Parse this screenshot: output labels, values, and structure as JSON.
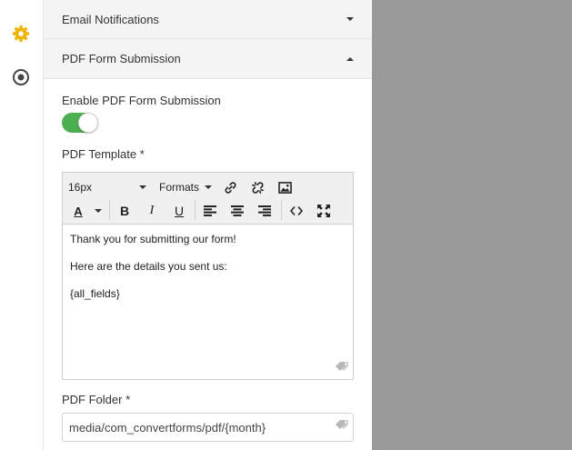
{
  "rail": {
    "icons": [
      "gear-icon",
      "target-icon"
    ],
    "gear_color": "#f0b400"
  },
  "accordion": {
    "email_notifications": {
      "label": "Email Notifications"
    },
    "pdf_form_submission": {
      "label": "PDF Form Submission"
    }
  },
  "pdf": {
    "enable_label": "Enable PDF Form Submission",
    "enabled": true,
    "toggle_color": "#4caf50",
    "template_label": "PDF Template *",
    "editor": {
      "font_size": "16px",
      "formats_label": "Formats",
      "content": [
        "Thank you for submitting our form!",
        "Here are the details you sent us:",
        "{all_fields}"
      ]
    },
    "folder_label": "PDF Folder *",
    "folder_value": "media/com_convertforms/pdf/{month}"
  }
}
